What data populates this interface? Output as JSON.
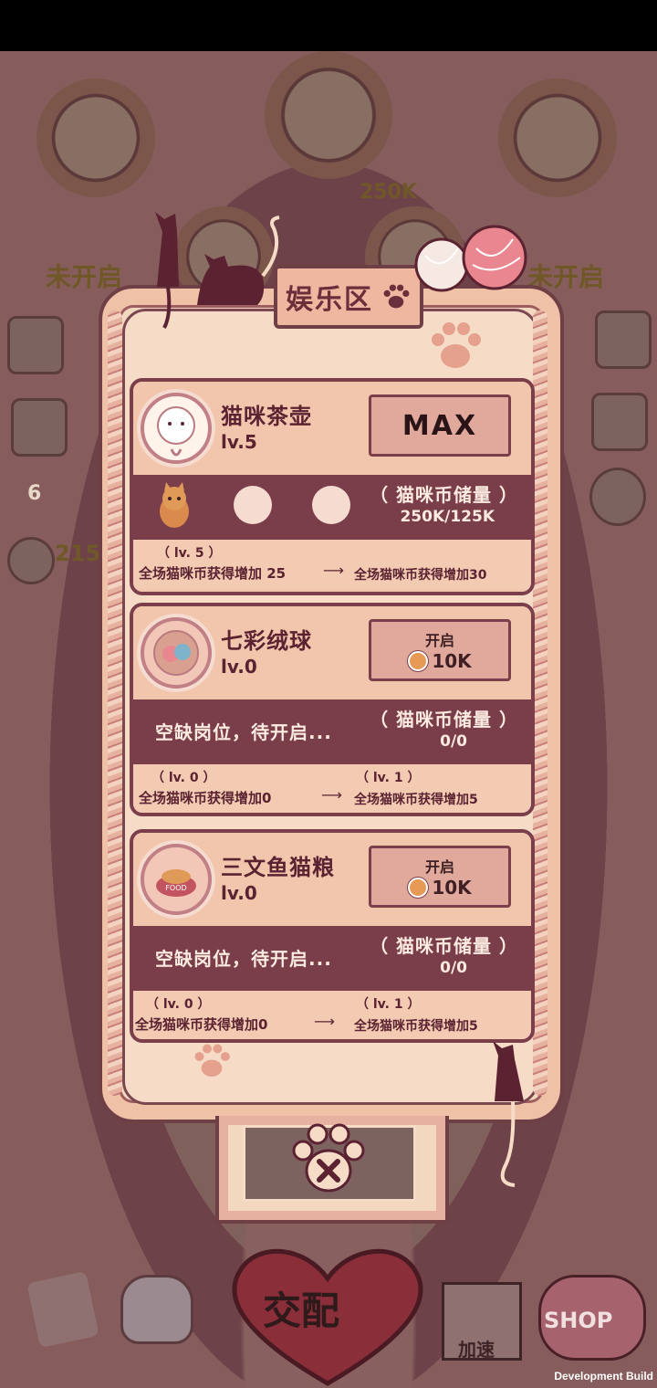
{
  "background": {
    "left_label": "未开启",
    "right_label": "未开启",
    "center_value": "250K",
    "left_counter": "6",
    "left_coins": "215",
    "speed_label": "加速",
    "shop_label": "SHOP",
    "pair_label": "交配"
  },
  "panel": {
    "title": "娱乐区"
  },
  "cards": [
    {
      "name": "猫咪茶壶",
      "level": "lv.5",
      "button": {
        "label": "MAX"
      },
      "storage_label": "（ 猫咪币储量 ）",
      "storage_value": "250K/125K",
      "current_level": "（ lv. 5 ）",
      "current_bonus": "全场猫咪币获得增加 25",
      "next_level": "",
      "next_bonus": "全场猫咪币获得增加30"
    },
    {
      "name": "七彩绒球",
      "level": "lv.0",
      "button": {
        "label": "开启",
        "price": "10K"
      },
      "vacant": "空缺岗位，待开启...",
      "storage_label": "（ 猫咪币储量 ）",
      "storage_value": "0/0",
      "current_level": "（ lv. 0 ）",
      "current_bonus": "全场猫咪币获得增加0",
      "next_level": "（ lv. 1 ）",
      "next_bonus": "全场猫咪币获得增加5"
    },
    {
      "name": "三文鱼猫粮",
      "level": "lv.0",
      "button": {
        "label": "开启",
        "price": "10K"
      },
      "vacant": "空缺岗位，待开启...",
      "storage_label": "（ 猫咪币储量 ）",
      "storage_value": "0/0",
      "current_level": "（ lv. 0 ）",
      "current_bonus": "全场猫咪币获得增加0",
      "next_level": "（ lv. 1 ）",
      "next_bonus": "全场猫咪币获得增加5",
      "icon_text": "FOOD"
    }
  ],
  "footer": "Development Build",
  "colors": {
    "panel_bg": "#f3d8c0",
    "card_bg": "#f2c5ad",
    "band": "#7a3d4a",
    "outline": "#6f3f46"
  }
}
